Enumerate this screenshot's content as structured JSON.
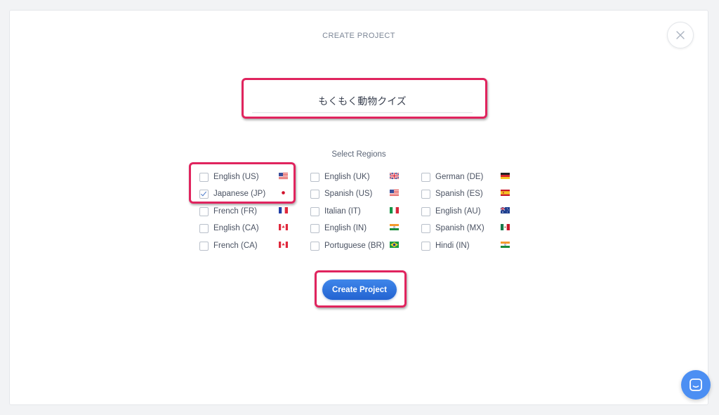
{
  "modal": {
    "title": "CREATE PROJECT",
    "close_icon": "close-icon"
  },
  "project_name": {
    "value": "もくもく動物クイズ"
  },
  "regions": {
    "label": "Select Regions",
    "items": [
      {
        "label": "English (US)",
        "checked": false,
        "flag": "us-flag-icon"
      },
      {
        "label": "Japanese (JP)",
        "checked": true,
        "flag": "jp-flag-icon"
      },
      {
        "label": "French (FR)",
        "checked": false,
        "flag": "fr-flag-icon"
      },
      {
        "label": "English (CA)",
        "checked": false,
        "flag": "ca-flag-icon"
      },
      {
        "label": "French (CA)",
        "checked": false,
        "flag": "ca-flag-icon"
      },
      {
        "label": "English (UK)",
        "checked": false,
        "flag": "uk-flag-icon"
      },
      {
        "label": "Spanish (US)",
        "checked": false,
        "flag": "us-flag-icon"
      },
      {
        "label": "Italian (IT)",
        "checked": false,
        "flag": "it-flag-icon"
      },
      {
        "label": "English (IN)",
        "checked": false,
        "flag": "in-flag-icon"
      },
      {
        "label": "Portuguese (BR)",
        "checked": false,
        "flag": "br-flag-icon"
      },
      {
        "label": "German (DE)",
        "checked": false,
        "flag": "de-flag-icon"
      },
      {
        "label": "Spanish (ES)",
        "checked": false,
        "flag": "es-flag-icon"
      },
      {
        "label": "English (AU)",
        "checked": false,
        "flag": "au-flag-icon"
      },
      {
        "label": "Spanish (MX)",
        "checked": false,
        "flag": "mx-flag-icon"
      },
      {
        "label": "Hindi (IN)",
        "checked": false,
        "flag": "in-flag-icon"
      }
    ]
  },
  "actions": {
    "create_label": "Create Project"
  },
  "chat": {
    "icon": "chat-icon"
  },
  "colors": {
    "highlight": "#e0245e",
    "primary": "#2f74dd",
    "chat": "#4c8ff3"
  }
}
